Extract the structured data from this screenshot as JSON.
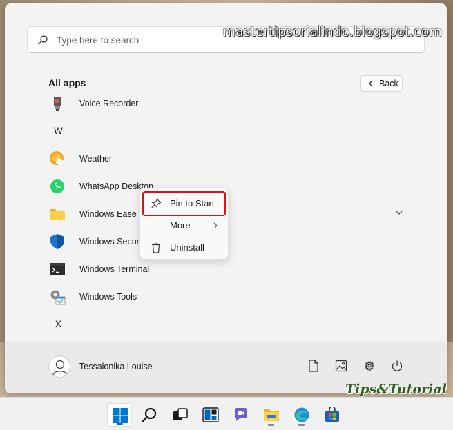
{
  "search": {
    "placeholder": "Type here to search"
  },
  "watermarks": {
    "top": "mastertipsorialindo.blogspot.com",
    "bottom": "Tips&Tutorial"
  },
  "all_apps": {
    "title": "All apps",
    "back_label": "Back"
  },
  "apps": [
    {
      "label": "Voice Recorder",
      "icon": "voice-recorder-icon"
    },
    {
      "letter": "W"
    },
    {
      "label": "Weather",
      "icon": "weather-icon"
    },
    {
      "label": "WhatsApp Desktop",
      "icon": "whatsapp-icon"
    },
    {
      "label": "Windows Ease of Access",
      "icon": "folder-icon"
    },
    {
      "label": "Windows Security",
      "icon": "shield-icon"
    },
    {
      "label": "Windows Terminal",
      "icon": "terminal-icon"
    },
    {
      "label": "Windows Tools",
      "icon": "tools-icon"
    },
    {
      "letter": "X"
    }
  ],
  "context_menu": {
    "items": [
      {
        "label": "Pin to Start",
        "icon": "pin-icon"
      },
      {
        "label": "More",
        "icon": "chevron-right-icon"
      },
      {
        "label": "Uninstall",
        "icon": "trash-icon"
      }
    ]
  },
  "user": {
    "name": "Tessalonika Louise"
  },
  "bottom_icons": [
    "document-icon",
    "pictures-icon",
    "settings-icon",
    "power-icon"
  ],
  "taskbar": [
    "windows-start-icon",
    "search-icon",
    "task-view-icon",
    "widgets-icon",
    "teams-chat-icon",
    "file-explorer-icon",
    "edge-icon",
    "store-icon"
  ],
  "colors": {
    "accent": "#0067c0",
    "highlight": "#d6121c",
    "whatsapp": "#25d366",
    "weather": "#f5a623"
  }
}
